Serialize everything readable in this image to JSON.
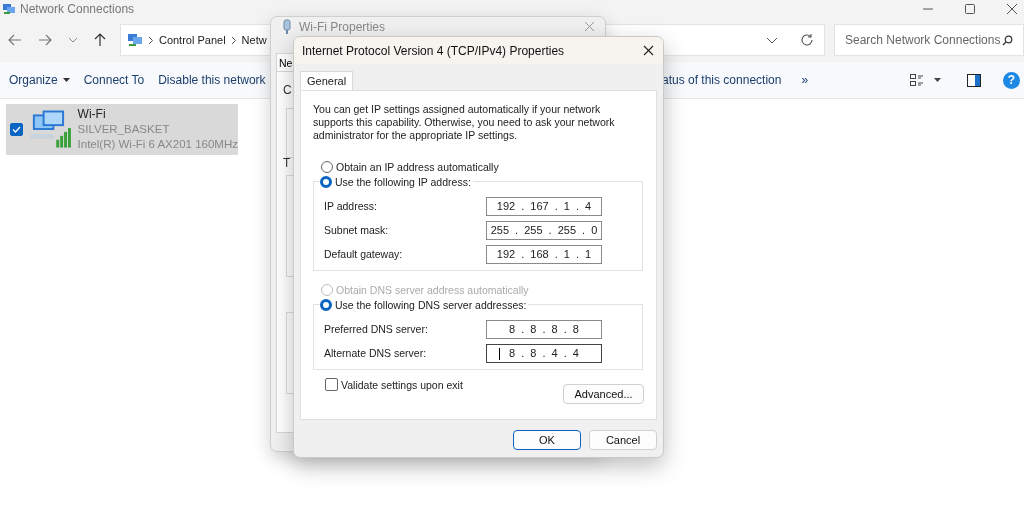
{
  "window": {
    "title": "Network Connections"
  },
  "address_bar": {
    "crumbs": [
      "Control Panel",
      "Netw"
    ]
  },
  "search": {
    "placeholder": "Search Network Connections"
  },
  "commands": [
    {
      "label": "Organize",
      "dropdown": true
    },
    {
      "label": "Connect To",
      "dropdown": false
    },
    {
      "label": "Disable this network",
      "dropdown": false
    }
  ],
  "commands_right": [
    {
      "label": "atus of this connection"
    },
    {
      "label": "»"
    }
  ],
  "help_glyph": "?",
  "connections": [
    {
      "name": "Wi-Fi",
      "network": "SILVER_BASKET",
      "adapter": "Intel(R) Wi-Fi 6 AX201 160MHz",
      "selected": true,
      "checked": true
    }
  ],
  "wifi_properties": {
    "title": "Wi-Fi Properties",
    "tab": "Ne",
    "label_1": "C",
    "label_2": "T"
  },
  "ipv4_dialog": {
    "title": "Internet Protocol Version 4 (TCP/IPv4) Properties",
    "tabs": [
      {
        "label": "General",
        "selected": true
      }
    ],
    "intro": "You can get IP settings assigned automatically if your network supports this capability. Otherwise, you need to ask your network administrator for the appropriate IP settings.",
    "ip_options": [
      {
        "label": "Obtain an IP address automatically",
        "selected": false,
        "disabled": false
      },
      {
        "label": "Use the following IP address:",
        "selected": true,
        "disabled": false
      }
    ],
    "ip_fields": [
      {
        "label": "IP address:",
        "value": "192 . 167 . 1 . 4",
        "focused": false
      },
      {
        "label": "Subnet mask:",
        "value": "255 . 255 . 255 . 0",
        "focused": false
      },
      {
        "label": "Default gateway:",
        "value": "192 . 168 . 1 . 1",
        "focused": false
      }
    ],
    "dns_options": [
      {
        "label": "Obtain DNS server address automatically",
        "selected": false,
        "disabled": true
      },
      {
        "label": "Use the following DNS server addresses:",
        "selected": true,
        "disabled": false
      }
    ],
    "dns_fields": [
      {
        "label": "Preferred DNS server:",
        "value": "8 . 8 . 8 . 8",
        "focused": false
      },
      {
        "label": "Alternate DNS server:",
        "value": "8 . 8 . 4 . 4",
        "focused": true
      }
    ],
    "validate": {
      "label": "Validate settings upon exit",
      "checked": false
    },
    "advanced_button": "Advanced...",
    "buttons": [
      {
        "label": "OK",
        "default": true
      },
      {
        "label": "Cancel",
        "default": false
      }
    ]
  }
}
